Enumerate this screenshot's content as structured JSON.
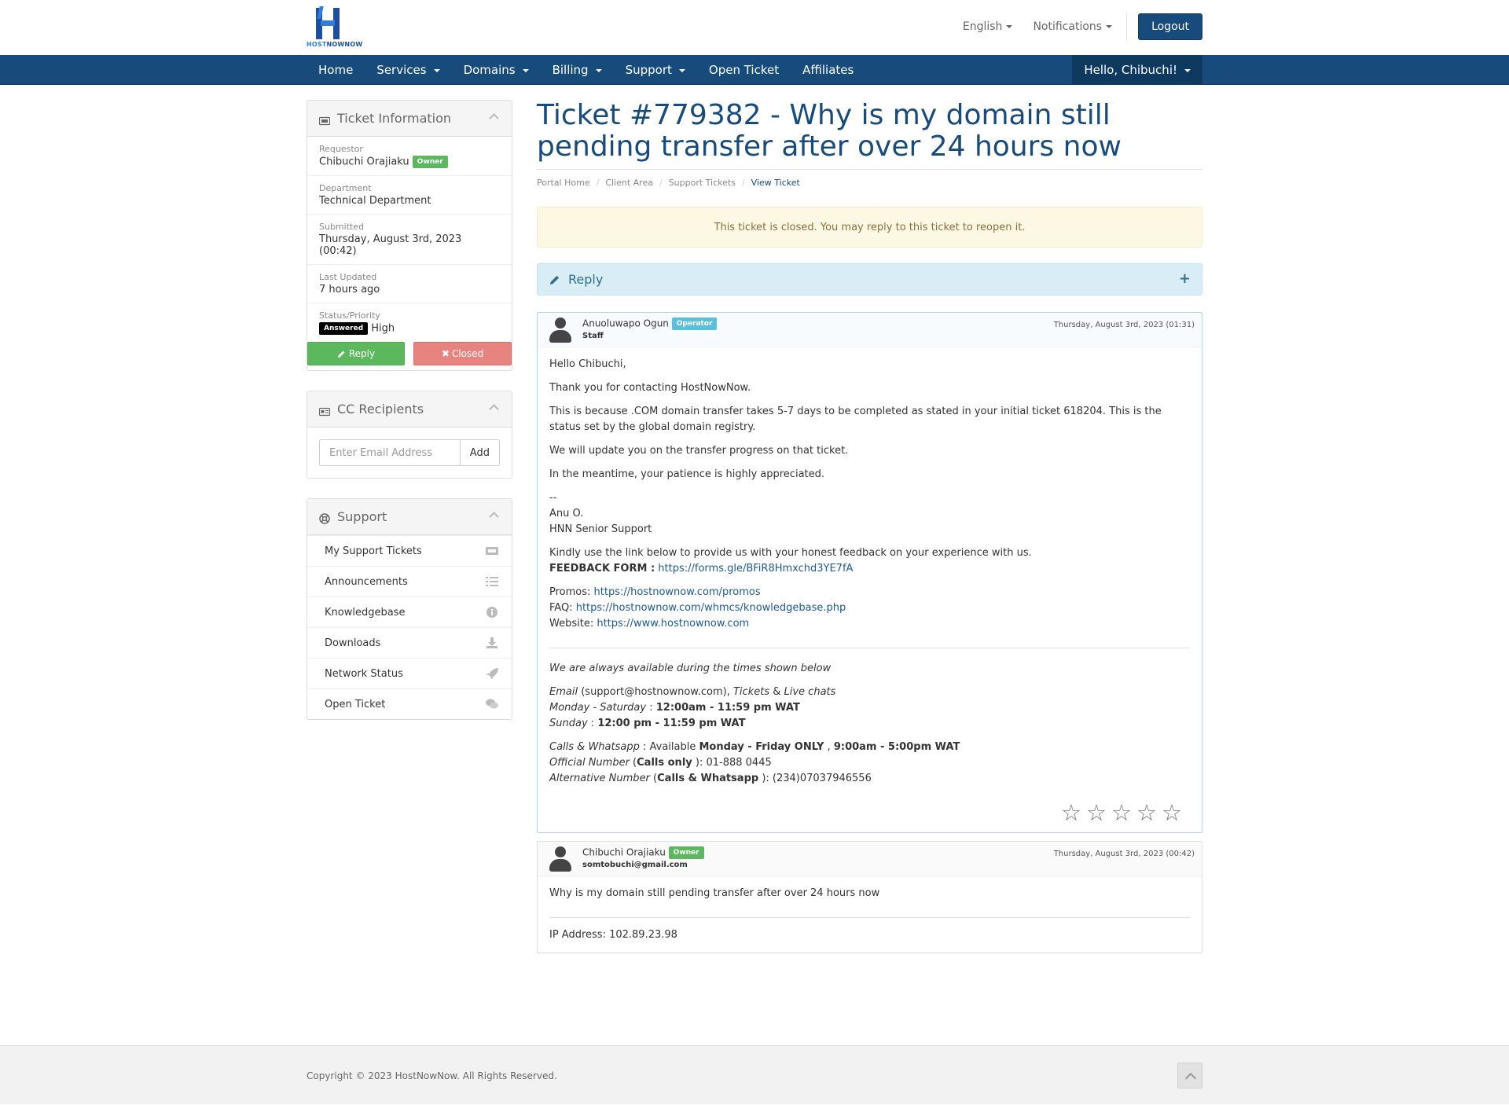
{
  "header": {
    "logo_text_a": "HOST",
    "logo_text_b": "NOWNOW",
    "language": "English",
    "notifications": "Notifications",
    "logout": "Logout"
  },
  "nav": {
    "items": [
      "Home",
      "Services",
      "Domains",
      "Billing",
      "Support",
      "Open Ticket",
      "Affiliates"
    ],
    "user": "Hello, Chibuchi!"
  },
  "ticket_info": {
    "heading": "Ticket Information",
    "requestor_label": "Requestor",
    "requestor_value": "Chibuchi Orajiaku",
    "requestor_badge": "Owner",
    "department_label": "Department",
    "department_value": "Technical Department",
    "submitted_label": "Submitted",
    "submitted_value": "Thursday, August 3rd, 2023 (00:42)",
    "updated_label": "Last Updated",
    "updated_value": "7 hours ago",
    "status_label": "Status/Priority",
    "status_badge": "Answered",
    "priority_value": "High",
    "reply_btn": "Reply",
    "closed_btn": "Closed"
  },
  "cc": {
    "heading": "CC Recipients",
    "placeholder": "Enter Email Address",
    "add": "Add"
  },
  "support": {
    "heading": "Support",
    "items": [
      "My Support Tickets",
      "Announcements",
      "Knowledgebase",
      "Downloads",
      "Network Status",
      "Open Ticket"
    ]
  },
  "main": {
    "title": "Ticket #779382 - Why is my domain still pending transfer after over 24 hours now",
    "breadcrumb": [
      "Portal Home",
      "Client Area",
      "Support Tickets",
      "View Ticket"
    ],
    "alert": "This ticket is closed. You may reply to this ticket to reopen it.",
    "reply_label": "Reply"
  },
  "messages": [
    {
      "name": "Anuoluwapo Ogun",
      "badge": "Operator",
      "sub": "Staff",
      "date": "Thursday, August 3rd, 2023 (01:31)",
      "lines": {
        "greeting": "Hello Chibuchi,",
        "thanks": "Thank you for contacting HostNowNow.",
        "reason": "This is because .COM domain transfer takes 5-7 days to be completed as stated in your initial ticket 618204. This is the status set by the global domain registry.",
        "update": "We will update you on the transfer progress on that ticket.",
        "patience": "In the meantime, your patience is highly appreciated.",
        "dashes": "--",
        "sig_name": "Anu O.",
        "sig_role": "HNN Senior Support",
        "feedback_text": "Kindly use the link below to provide us with your honest feedback on your experience with us.",
        "feedback_label": "FEEDBACK FORM :",
        "feedback_link": "https://forms.gle/BFiR8Hmxchd3YE7fA",
        "promos_label": "Promos:",
        "promos_link": "https://hostnownow.com/promos",
        "faq_label": "FAQ:",
        "faq_link": "https://hostnownow.com/whmcs/knowledgebase.php",
        "website_label": "Website:",
        "website_link": "https://www.hostnownow.com",
        "avail": "We are always available during the times shown below",
        "email_a": "Email",
        "email_b": "(support@hostnownow.com),",
        "email_c": "Tickets",
        "email_d": "&",
        "email_e": "Live chats",
        "ms_label": "Monday - Saturday",
        "ms_value": "12:00am - 11:59 pm WAT",
        "sun_label": "Sunday",
        "sun_value": "12:00 pm - 11:59 pm WAT",
        "calls_label": "Calls & Whatsapp",
        "calls_mid": ": Available",
        "calls_days": "Monday - Friday ONLY",
        "calls_sep": ",",
        "calls_hours": "9:00am - 5:00pm WAT",
        "official_label": "Official Number",
        "official_kind": "Calls only",
        "official_number": "): 01-888 0445",
        "alt_label": "Alternative Number",
        "alt_kind": "Calls & Whatsapp",
        "alt_number": "): (234)07037946556"
      },
      "rating_max": 5,
      "rating": 0
    },
    {
      "name": "Chibuchi Orajiaku",
      "badge": "Owner",
      "sub": "somtobuchi@gmail.com",
      "date": "Thursday, August 3rd, 2023 (00:42)",
      "body": "Why is my domain still pending transfer after over 24 hours now",
      "ip": "IP Address: 102.89.23.98"
    }
  ],
  "footer": {
    "copyright": "Copyright © 2023 HostNowNow. All Rights Reserved."
  },
  "colors": {
    "brand": "#174b7c",
    "success": "#5cb85c",
    "danger_light": "#e8847f",
    "info_badge": "#5bc0de",
    "warning_bg": "#fcf8e3",
    "info_bg": "#d9edf7"
  }
}
